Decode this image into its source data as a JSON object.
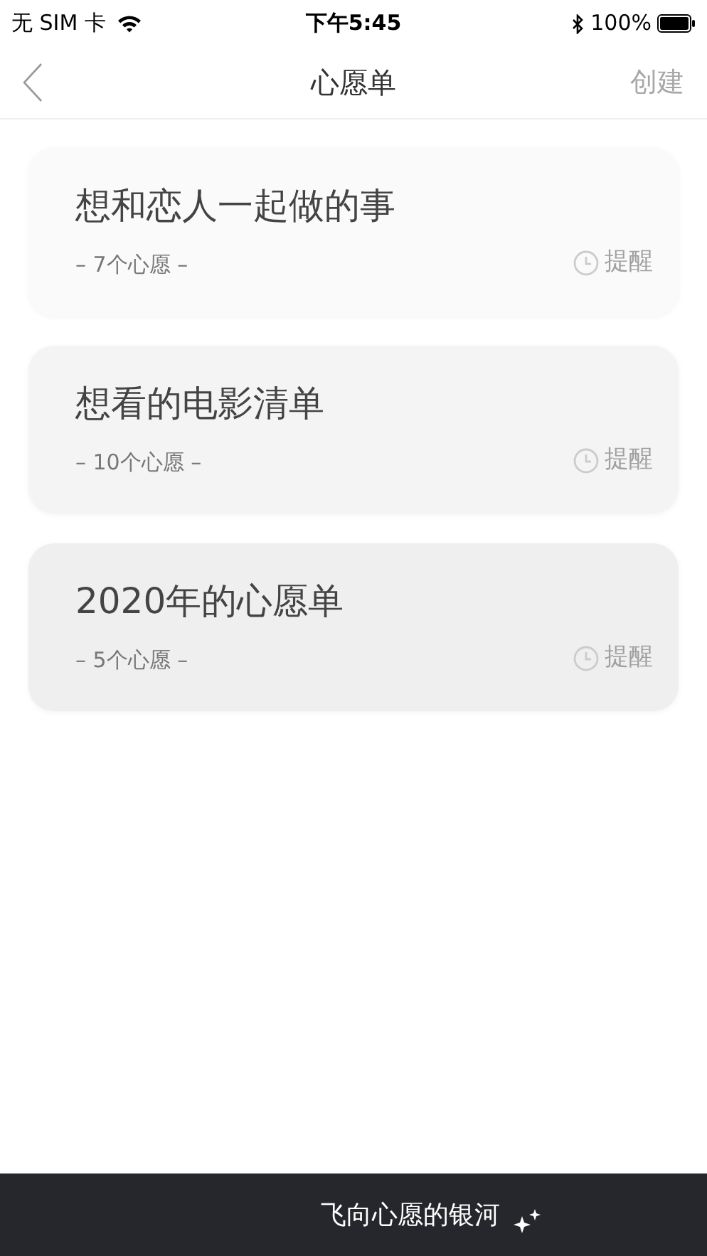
{
  "status_bar": {
    "carrier": "无 SIM 卡",
    "time": "下午5:45",
    "battery": "100%"
  },
  "nav": {
    "title": "心愿单",
    "action": "创建",
    "action_disabled": true
  },
  "lists": [
    {
      "title": "想和恋人一起做的事",
      "count": "– 7个心愿 –",
      "reminder": "提醒",
      "color": "#fafafa"
    },
    {
      "title": "想看的电影清单",
      "count": "– 10个心愿 –",
      "reminder": "提醒",
      "color": "#f4f4f4"
    },
    {
      "title": "2020年的心愿单",
      "count": "– 5个心愿 –",
      "reminder": "提醒",
      "color": "#efefef"
    }
  ],
  "bottom_bar": {
    "label": "飞向心愿的银河"
  }
}
